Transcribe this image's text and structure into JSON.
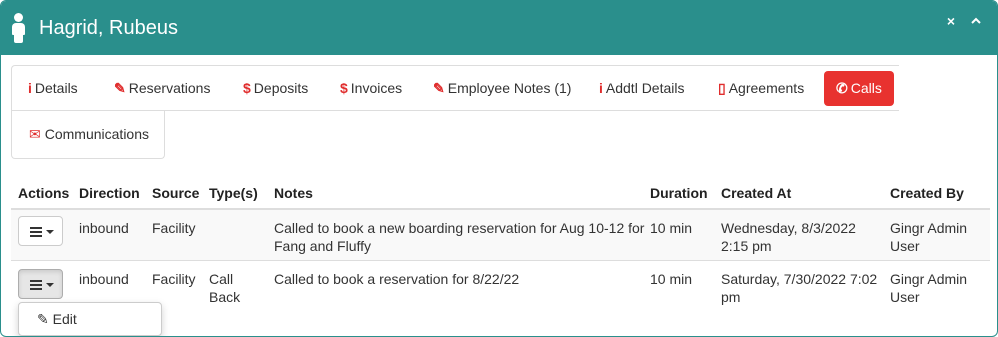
{
  "window": {
    "title": "Hagrid, Rubeus",
    "close_icon": "×",
    "collapse_icon": "^",
    "header_color": "#2a8f8c"
  },
  "tabs": [
    {
      "label": "Details",
      "icon": "info-icon",
      "glyph": "i"
    },
    {
      "label": "Reservations",
      "icon": "edit-icon",
      "glyph": "✎"
    },
    {
      "label": "Deposits",
      "icon": "dollar-icon",
      "glyph": "$"
    },
    {
      "label": "Invoices",
      "icon": "dollar-icon",
      "glyph": "$"
    },
    {
      "label": "Employee Notes (1)",
      "icon": "pencil-icon",
      "glyph": "✎"
    },
    {
      "label": "Addtl Details",
      "icon": "info-icon",
      "glyph": "i"
    },
    {
      "label": "Agreements",
      "icon": "clipboard-icon",
      "glyph": "▯"
    },
    {
      "label": "Calls",
      "icon": "phone-icon",
      "glyph": "✆",
      "active": true
    },
    {
      "label": "Communications",
      "icon": "comments-icon",
      "glyph": "✉"
    }
  ],
  "accent_color": "#e8322f",
  "table": {
    "headers": [
      "Actions",
      "Direction",
      "Source",
      "Type(s)",
      "Notes",
      "Duration",
      "Created At",
      "Created By"
    ],
    "rows": [
      {
        "direction": "inbound",
        "source": "Facility",
        "types": "",
        "notes_line1": "Called to book a new boarding reservation for Aug 10-12 for",
        "notes_line2": "Fang and Fluffy",
        "duration": "10 min",
        "created_at_line1": "Wednesday, 8/3/2022",
        "created_at_line2": "2:15 pm",
        "created_by_line1": "Gingr Admin",
        "created_by_line2": "User"
      },
      {
        "direction": "inbound",
        "source": "Facility",
        "types_line1": "Call",
        "types_line2": "Back",
        "notes_line1": "Called to book a reservation for 8/22/22",
        "duration": "10 min",
        "created_at_line1": "Saturday, 7/30/2022 7:02",
        "created_at_line2": "pm",
        "created_by_line1": "Gingr Admin",
        "created_by_line2": "User"
      }
    ]
  },
  "actions_menu": {
    "items": [
      {
        "label": "Edit",
        "icon": "pencil-icon",
        "glyph": "✎"
      }
    ]
  }
}
